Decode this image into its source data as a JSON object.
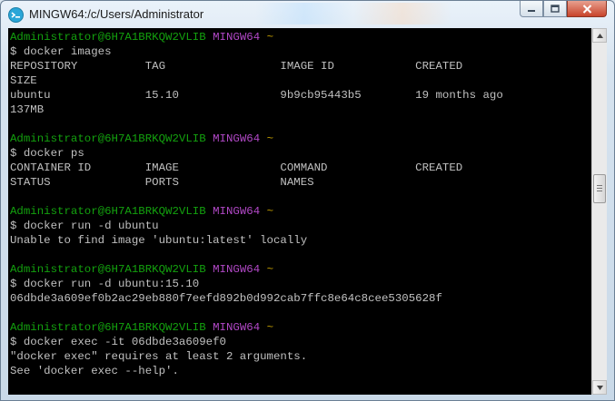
{
  "window": {
    "title": "MINGW64:/c/Users/Administrator"
  },
  "colors": {
    "user_host": "#13a10e",
    "shell_name": "#b148c6",
    "cwd": "#c19c00",
    "text": "#c0c0c0",
    "background": "#000000"
  },
  "prompt": {
    "user_host": "Administrator@6H7A1BRKQW2VLIB",
    "shell": "MINGW64",
    "cwd": "~"
  },
  "terminal": {
    "lines": [
      {
        "type": "prompt"
      },
      {
        "type": "text",
        "text": "$ docker images"
      },
      {
        "type": "text",
        "text": "REPOSITORY          TAG                 IMAGE ID            CREATED"
      },
      {
        "type": "text",
        "text": "SIZE"
      },
      {
        "type": "text",
        "text": "ubuntu              15.10               9b9cb95443b5        19 months ago"
      },
      {
        "type": "text",
        "text": "137MB"
      },
      {
        "type": "text",
        "text": ""
      },
      {
        "type": "prompt"
      },
      {
        "type": "text",
        "text": "$ docker ps"
      },
      {
        "type": "text",
        "text": "CONTAINER ID        IMAGE               COMMAND             CREATED"
      },
      {
        "type": "text",
        "text": "STATUS              PORTS               NAMES"
      },
      {
        "type": "text",
        "text": ""
      },
      {
        "type": "prompt"
      },
      {
        "type": "text",
        "text": "$ docker run -d ubuntu"
      },
      {
        "type": "text",
        "text": "Unable to find image 'ubuntu:latest' locally"
      },
      {
        "type": "text",
        "text": ""
      },
      {
        "type": "prompt"
      },
      {
        "type": "text",
        "text": "$ docker run -d ubuntu:15.10"
      },
      {
        "type": "text",
        "text": "06dbde3a609ef0b2ac29eb880f7eefd892b0d992cab7ffc8e64c8cee5305628f"
      },
      {
        "type": "text",
        "text": ""
      },
      {
        "type": "prompt"
      },
      {
        "type": "text",
        "text": "$ docker exec -it 06dbde3a609ef0"
      },
      {
        "type": "text",
        "text": "\"docker exec\" requires at least 2 arguments."
      },
      {
        "type": "text",
        "text": "See 'docker exec --help'."
      }
    ]
  },
  "scrollbar": {
    "position_fraction": 0.42
  }
}
